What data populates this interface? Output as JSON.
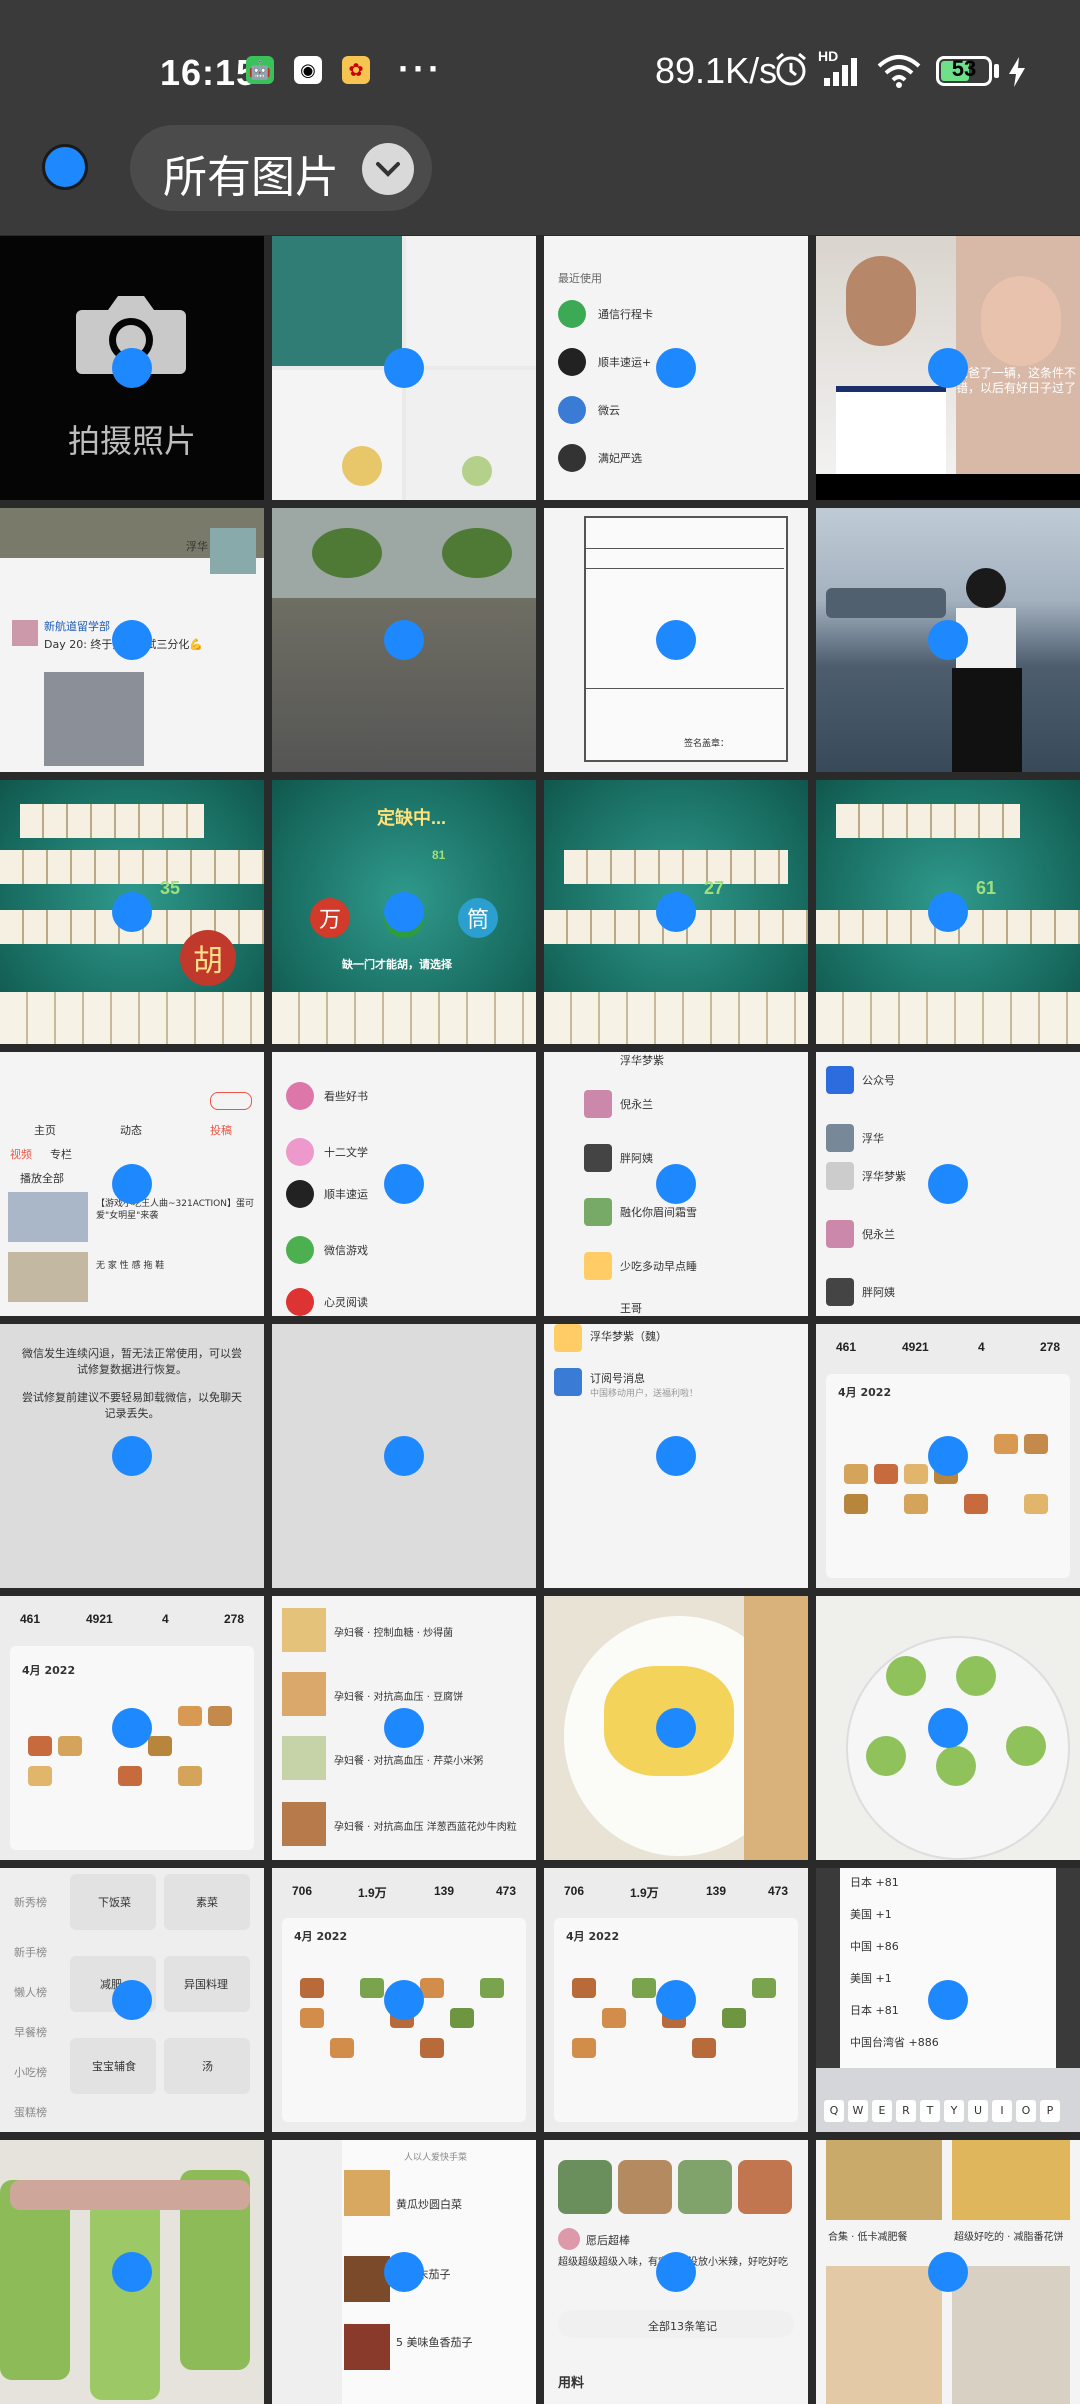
{
  "status_bar": {
    "time": "16:15",
    "network_speed": "89.1K/s",
    "network_type": "HD",
    "battery_level": "53"
  },
  "header": {
    "album_label": "所有图片"
  },
  "grid": {
    "camera_cell_label": "拍摄照片",
    "cells": [
      {
        "type": "camera"
      },
      {
        "type": "screenshot-grid"
      },
      {
        "type": "app-list",
        "items": [
          "最近使用",
          "通信行程卡",
          "顺丰速运+",
          "微云",
          "满妃严选"
        ]
      },
      {
        "type": "photo-family",
        "caption": "爸爸了一辆，这条件不错，以后有好日子过了"
      },
      {
        "type": "social-post",
        "author": "浮华",
        "text": "新航道留学部",
        "text2": "Day 20: 终于开始尝试三分化💪"
      },
      {
        "type": "photo-trees"
      },
      {
        "type": "form-scan",
        "footer": "签名盖章："
      },
      {
        "type": "photo-lake"
      },
      {
        "type": "mahjong",
        "caption": "35"
      },
      {
        "type": "mahjong",
        "caption": "定缺中...",
        "badge": "81",
        "buttons": [
          "万",
          "条",
          "筒"
        ],
        "footer": "缺一门才能胡，请选择"
      },
      {
        "type": "mahjong",
        "caption": "27"
      },
      {
        "type": "mahjong",
        "caption": "61"
      },
      {
        "type": "profile-page",
        "tabs": [
          "主页",
          "动态",
          "投稿"
        ],
        "sub_tabs": [
          "视频",
          "专栏"
        ],
        "play_all": "播放全部",
        "item1": "【游戏小吃王人曲~321ACTION】蛋可爱\"女明星\"来袭",
        "item2": "无 家 性 感 拖 鞋"
      },
      {
        "type": "contacts",
        "items": [
          "看些好书",
          "十二文学",
          "顺丰速运",
          "微信游戏",
          "心灵阅读"
        ]
      },
      {
        "type": "contacts2",
        "items": [
          "浮华梦紫",
          "倪永兰",
          "胖阿姨",
          "融化你眉间霜雪",
          "少吃多动早点睡",
          "王哥"
        ]
      },
      {
        "type": "contacts3",
        "items": [
          "公众号",
          "浮华",
          "浮华梦紫",
          "倪永兰",
          "胖阿姨"
        ]
      },
      {
        "type": "error-msg",
        "line1": "微信发生连续闪退，暂无法正常使用，可以尝试修复数据进行恢复。",
        "line2": "尝试修复前建议不要轻易卸载微信，以免聊天记录丢失。"
      },
      {
        "type": "blank"
      },
      {
        "type": "chat-list",
        "item1": "浮华梦紫（魏）",
        "item2": "订阅号消息",
        "sub2": "中国移动用户，送福利啦！"
      },
      {
        "type": "calendar",
        "stats": [
          "461",
          "4921",
          "4",
          "278"
        ],
        "month": "4月 2022"
      },
      {
        "type": "calendar",
        "stats": [
          "461",
          "4921",
          "4",
          "278"
        ],
        "month": "4月 2022"
      },
      {
        "type": "recipe-list",
        "items": [
          "孕妇餐 · 控制血糖 · 炒得菌",
          "孕妇餐 · 对抗高血压 · 豆腐饼",
          "孕妇餐 · 对抗高血压 · 芹菜小米粥",
          "孕妇餐 · 对抗高血压 洋葱西蓝花炒牛肉粒"
        ]
      },
      {
        "type": "photo-eggs"
      },
      {
        "type": "photo-stuffed-gourd"
      },
      {
        "type": "menu-grid",
        "items": [
          "下饭菜",
          "素菜",
          "减肥",
          "异国料理",
          "宝宝辅食",
          "汤"
        ],
        "side": [
          "新秀榜",
          "新手榜",
          "懒人榜",
          "早餐榜",
          "小吃榜",
          "蛋糕榜"
        ]
      },
      {
        "type": "calendar",
        "stats": [
          "706",
          "1.9万",
          "139",
          "473"
        ],
        "month": "4月 2022"
      },
      {
        "type": "calendar",
        "stats": [
          "706",
          "1.9万",
          "139",
          "473"
        ],
        "month": "4月 2022"
      },
      {
        "type": "country-codes",
        "items": [
          "日本 +81",
          "美国 +1",
          "中国 +86",
          "美国 +1",
          "日本 +81",
          "中国台湾省 +886"
        ],
        "keys": [
          "Q",
          "W",
          "E",
          "R",
          "T",
          "Y",
          "U",
          "I",
          "O",
          "P"
        ]
      },
      {
        "type": "photo-gourd-close"
      },
      {
        "type": "recipe-list2",
        "items": [
          "人以人爱快手菜",
          "黄瓜炒圆白菜",
          "4 肉末茄子",
          "5 美味鱼香茄子"
        ]
      },
      {
        "type": "notes",
        "author": "愿后超棒",
        "text": "超级超级超级入味，有宝宝吃没放小米辣，好吃好吃",
        "link": "全部13条笔记",
        "footer": "用料"
      },
      {
        "type": "recipe-cards",
        "item1": "合集 · 低卡减肥餐",
        "item2": "超级好吃的 · 减脂番花饼"
      }
    ]
  },
  "colors": {
    "select_blue": "#1e88ff",
    "status_bg": "#3a3a3a",
    "grid_bg": "#2a2a2a"
  }
}
